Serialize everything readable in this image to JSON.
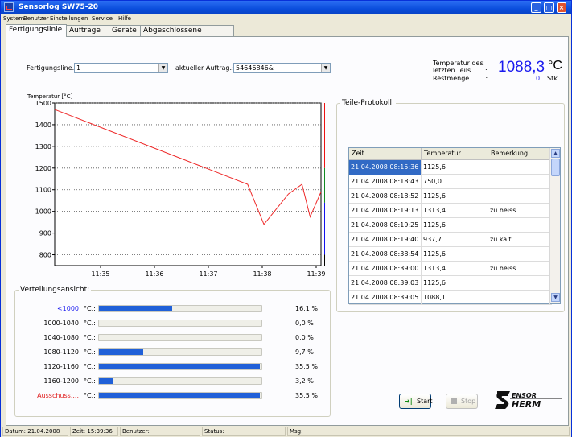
{
  "window": {
    "title": "Sensorlog SW75-20"
  },
  "menu": [
    "System",
    "Benutzer",
    "Einstellungen",
    "Service",
    "Hilfe"
  ],
  "tabs": [
    "Fertigungslinie",
    "Aufträge",
    "Geräte",
    "Abgeschlossene Aufträge"
  ],
  "form": {
    "line_label": "Fertigungsline.:",
    "line_value": "1",
    "order_label": "aktueller Auftrag.:",
    "order_value": "54646846&"
  },
  "temperature_panel": {
    "label": "Temperatur des letzten Teils.......:",
    "value": "1088,3",
    "unit": "°C",
    "rest_label": "Restmenge........:",
    "rest_value": "0",
    "rest_unit": "Stk"
  },
  "chart_data": {
    "type": "line",
    "ylabel": "Temperatur [°C]",
    "y_ticks": [
      1500,
      1400,
      1300,
      1200,
      1100,
      1000,
      900,
      800
    ],
    "ylim": [
      750,
      1500
    ],
    "x_ticks": [
      "11:35",
      "11:36",
      "11:37",
      "11:38",
      "11:39"
    ],
    "x": [
      0.0,
      3.55,
      3.85,
      4.3,
      4.55,
      4.7,
      4.9
    ],
    "values": [
      1470,
      1125,
      940,
      1080,
      1125,
      975,
      1090
    ],
    "series_color": "#ee2a2a",
    "grid": "dotted horizontal",
    "color_band": [
      {
        "color": "#ee1111",
        "from": 1500,
        "to": 1200
      },
      {
        "color": "#118a22",
        "from": 1200,
        "to": 1040
      },
      {
        "color": "#1111ee",
        "from": 1040,
        "to": 800
      },
      {
        "color": "#000000",
        "from": 800,
        "to": 750
      }
    ]
  },
  "protocol": {
    "title": "Teile-Protokoll:",
    "columns": [
      "Zeit",
      "Temperatur",
      "Bemerkung"
    ],
    "rows": [
      [
        "21.04.2008 08:15:36",
        "1125,6",
        ""
      ],
      [
        "21.04.2008 08:18:43",
        "750,0",
        ""
      ],
      [
        "21.04.2008 08:18:52",
        "1125,6",
        ""
      ],
      [
        "21.04.2008 08:19:13",
        "1313,4",
        "zu heiss"
      ],
      [
        "21.04.2008 08:19:25",
        "1125,6",
        ""
      ],
      [
        "21.04.2008 08:19:40",
        "937,7",
        "zu kalt"
      ],
      [
        "21.04.2008 08:38:54",
        "1125,6",
        ""
      ],
      [
        "21.04.2008 08:39:00",
        "1313,4",
        "zu heiss"
      ],
      [
        "21.04.2008 08:39:03",
        "1125,6",
        ""
      ],
      [
        "21.04.2008 08:39:05",
        "1088,1",
        ""
      ]
    ]
  },
  "distribution": {
    "title": "Verteilungsansicht:",
    "unit": "°C.:",
    "rows": [
      {
        "range": "<1000",
        "pct": "16,1 %",
        "fraction": 0.161,
        "color": "#1a1aef"
      },
      {
        "range": "1000-1040",
        "pct": "0,0 %",
        "fraction": 0.0,
        "color": "#000000"
      },
      {
        "range": "1040-1080",
        "pct": "0,0 %",
        "fraction": 0.0,
        "color": "#000000"
      },
      {
        "range": "1080-1120",
        "pct": "9,7 %",
        "fraction": 0.097,
        "color": "#000000"
      },
      {
        "range": "1120-1160",
        "pct": "35,5 %",
        "fraction": 0.355,
        "color": "#000000"
      },
      {
        "range": "1160-1200",
        "pct": "3,2 %",
        "fraction": 0.032,
        "color": "#000000"
      },
      {
        "range": "Ausschuss....",
        "pct": "35,5 %",
        "fraction": 0.355,
        "color": "#e02020"
      }
    ]
  },
  "buttons": {
    "start": "Start",
    "stop": "Stop"
  },
  "logo": {
    "text": "SENSORTHERM"
  },
  "status": {
    "date": "Datum: 21.04.2008",
    "time": "Zeit: 15:39:36",
    "user": "Benutzer:",
    "status": "Status:",
    "msg": "Msg:"
  }
}
